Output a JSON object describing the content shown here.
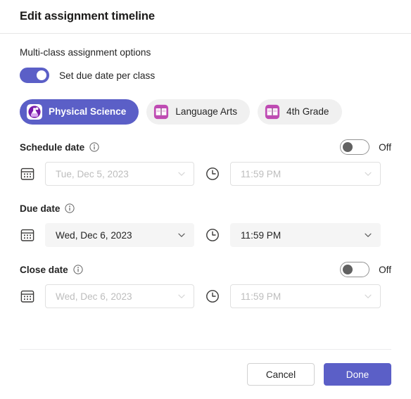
{
  "dialog": {
    "title": "Edit assignment timeline"
  },
  "multi_class": {
    "section_label": "Multi-class assignment options",
    "toggle_label": "Set due date per class",
    "toggle_state": "on"
  },
  "class_tabs": [
    {
      "label": "Physical Science",
      "icon": "science-flask-icon",
      "selected": true,
      "icon_color": "#7719aa"
    },
    {
      "label": "Language Arts",
      "icon": "open-book-icon",
      "selected": false,
      "icon_color": "#bf4bb3"
    },
    {
      "label": "4th Grade",
      "icon": "open-book-icon",
      "selected": false,
      "icon_color": "#bf4bb3"
    }
  ],
  "fields": [
    {
      "label": "Schedule date",
      "info_icon": "info-icon",
      "has_toggle": true,
      "toggle_state": "Off",
      "enabled": false,
      "date": {
        "value": "Tue, Dec 5, 2023",
        "icon": "calendar-icon"
      },
      "time": {
        "value": "11:59 PM",
        "icon": "clock-icon"
      }
    },
    {
      "label": "Due date",
      "info_icon": "info-icon",
      "has_toggle": false,
      "toggle_state": "",
      "enabled": true,
      "date": {
        "value": "Wed, Dec 6, 2023",
        "icon": "calendar-icon"
      },
      "time": {
        "value": "11:59 PM",
        "icon": "clock-icon"
      }
    },
    {
      "label": "Close date",
      "info_icon": "info-icon",
      "has_toggle": true,
      "toggle_state": "Off",
      "enabled": false,
      "date": {
        "value": "Wed, Dec 6, 2023",
        "icon": "calendar-icon"
      },
      "time": {
        "value": "11:59 PM",
        "icon": "clock-icon"
      }
    }
  ],
  "footer": {
    "cancel_label": "Cancel",
    "done_label": "Done"
  },
  "colors": {
    "accent": "#5b5fc7",
    "text": "#242424",
    "disabled_text": "#bdbdbd",
    "field_bg": "#f5f5f5",
    "pill_bg": "#f0f0f0",
    "divider": "#e6e6e6"
  }
}
